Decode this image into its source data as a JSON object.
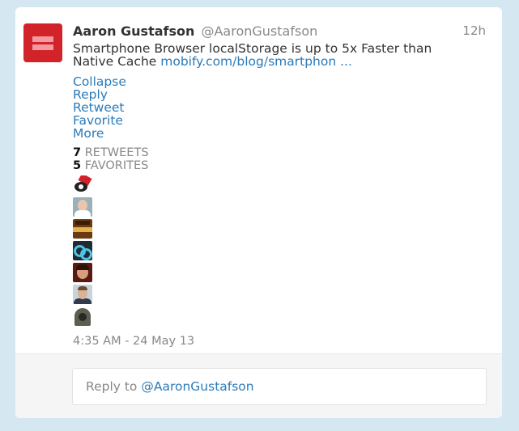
{
  "tweet": {
    "fullname": "Aaron Gustafson",
    "username": "@AaronGustafson",
    "time": "12h",
    "text_line1": "Smartphone Browser localStorage is up to 5x Faster than",
    "text_line2_prefix": "Native Cache ",
    "link": "mobify.com/blog/smartphon ...",
    "timestamp": "4:35 AM - 24 May 13"
  },
  "actions": [
    "Collapse",
    "Reply",
    "Retweet",
    "Favorite",
    "More"
  ],
  "stats": {
    "retweets_count": "7",
    "retweets_label": "RETWEETS",
    "favorites_count": "5",
    "favorites_label": "FAVORITES"
  },
  "reply": {
    "prefix": "Reply to ",
    "mention": "@AaronGustafson"
  },
  "colors": {
    "background": "#d5e8f2",
    "link": "#2b7bb9",
    "avatar_red": "#d2232a"
  },
  "icons": [
    "avatar-equality-logo",
    "favoriter-avatar"
  ]
}
